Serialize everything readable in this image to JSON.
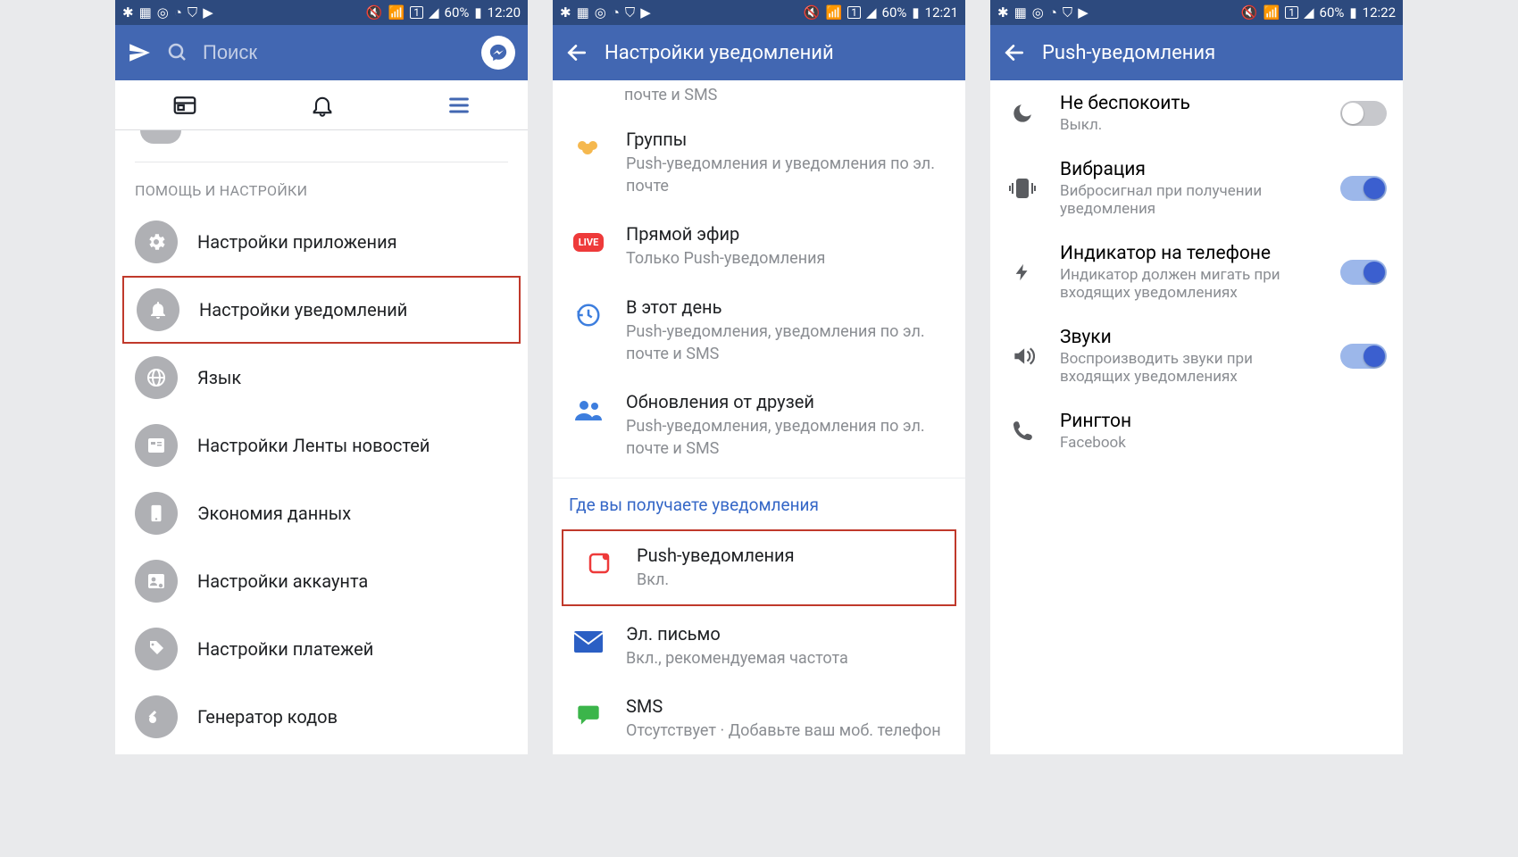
{
  "status": {
    "battery": "60%",
    "sim_label": "1"
  },
  "screen1": {
    "time": "12:20",
    "search_placeholder": "Поиск",
    "section": "ПОМОЩЬ И НАСТРОЙКИ",
    "items": [
      "Настройки приложения",
      "Настройки уведомлений",
      "Язык",
      "Настройки Ленты новостей",
      "Экономия данных",
      "Настройки аккаунта",
      "Настройки платежей",
      "Генератор кодов"
    ]
  },
  "screen2": {
    "time": "12:21",
    "title": "Настройки уведомлений",
    "truncated_tail": "почте и SMS",
    "rows": [
      {
        "title": "Группы",
        "sub": "Push-уведомления и уведомления по эл. почте"
      },
      {
        "title": "Прямой эфир",
        "sub": "Только Push-уведомления"
      },
      {
        "title": "В этот день",
        "sub": "Push-уведомления, уведомления по эл. почте и SMS"
      },
      {
        "title": "Обновления от друзей",
        "sub": "Push-уведомления, уведомления по эл. почте и SMS"
      }
    ],
    "subheader": "Где вы получаете уведомления",
    "channels": [
      {
        "title": "Push-уведомления",
        "sub": "Вкл."
      },
      {
        "title": "Эл. письмо",
        "sub": "Вкл., рекомендуемая частота"
      },
      {
        "title": "SMS",
        "sub": "Отсутствует · Добавьте ваш моб. телефон"
      }
    ]
  },
  "screen3": {
    "time": "12:22",
    "title": "Push-уведомления",
    "items": [
      {
        "title": "Не беспокоить",
        "sub": "Выкл.",
        "on": false
      },
      {
        "title": "Вибрация",
        "sub": "Вибросигнал при получении уведомления",
        "on": true
      },
      {
        "title": "Индикатор на телефоне",
        "sub": "Индикатор должен мигать при входящих уведомлениях",
        "on": true
      },
      {
        "title": "Звуки",
        "sub": "Воспроизводить звуки при входящих уведомлениях",
        "on": true
      },
      {
        "title": "Рингтон",
        "sub": "Facebook"
      }
    ]
  }
}
